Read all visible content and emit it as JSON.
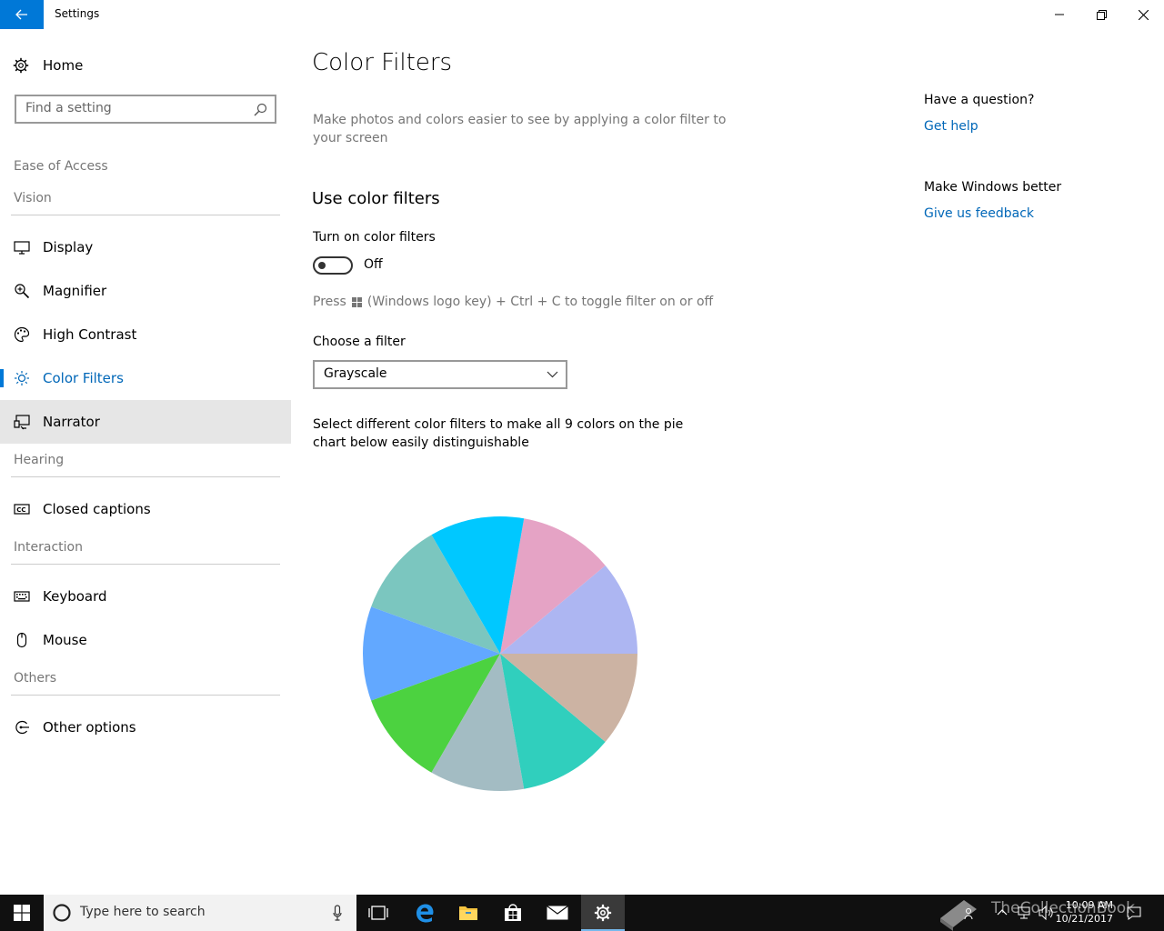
{
  "window": {
    "title": "Settings"
  },
  "sidebar": {
    "home_label": "Home",
    "search_placeholder": "Find a setting",
    "group_label": "Ease of Access",
    "sections": [
      "Vision",
      "Hearing",
      "Interaction",
      "Others"
    ],
    "items": [
      {
        "label": "Display",
        "icon": "monitor-icon"
      },
      {
        "label": "Magnifier",
        "icon": "magnifier-icon"
      },
      {
        "label": "High Contrast",
        "icon": "palette-icon"
      },
      {
        "label": "Color Filters",
        "icon": "sun-icon",
        "active": true
      },
      {
        "label": "Narrator",
        "icon": "narrator-icon",
        "hover": true
      },
      {
        "label": "Closed captions",
        "icon": "cc-icon"
      },
      {
        "label": "Keyboard",
        "icon": "keyboard-icon"
      },
      {
        "label": "Mouse",
        "icon": "mouse-icon"
      },
      {
        "label": "Other options",
        "icon": "other-options-icon"
      }
    ]
  },
  "main": {
    "title": "Color Filters",
    "description": "Make photos and colors easier to see by applying a color filter to your screen",
    "section_title": "Use color filters",
    "toggle_label": "Turn on color filters",
    "toggle_state": "Off",
    "toggle_on": false,
    "shortcut_prefix": "Press",
    "shortcut_suffix": "(Windows logo key) + Ctrl + C to toggle filter on or off",
    "filter_label": "Choose a filter",
    "filter_value": "Grayscale",
    "pie_description": "Select different color filters to make all 9 colors on the pie chart below easily distinguishable",
    "pie_colors": [
      "#adb6f2",
      "#e5a3c5",
      "#00c8ff",
      "#7bc6bf",
      "#62a8ff",
      "#4cd240",
      "#a3bcc3",
      "#30cfbd",
      "#ccb3a3"
    ]
  },
  "right": {
    "question_title": "Have a question?",
    "get_help": "Get help",
    "feedback_title": "Make Windows better",
    "feedback_link": "Give us feedback"
  },
  "taskbar": {
    "search_placeholder": "Type here to search",
    "time": "10:09 AM",
    "date": "10/21/2017",
    "watermark": "TheCollectionBook"
  }
}
